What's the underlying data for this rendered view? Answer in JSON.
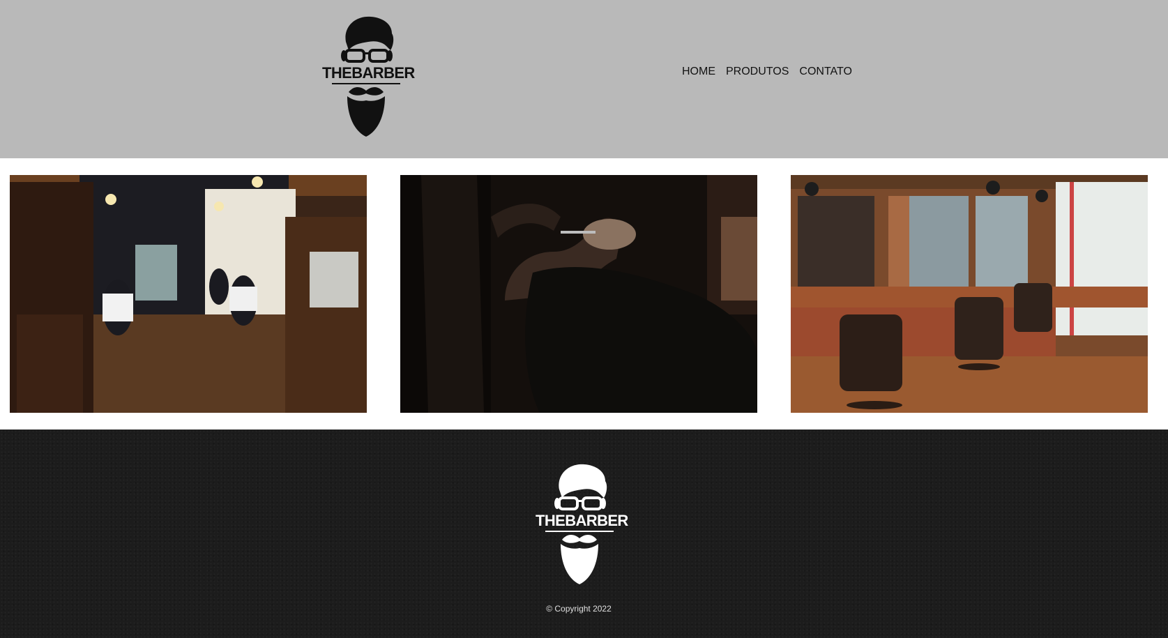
{
  "header": {
    "logo_text": "THEBARBER",
    "logo_icon": "bearded-man-glasses-icon",
    "nav": [
      {
        "label": "HOME"
      },
      {
        "label": "PRODUTOS"
      },
      {
        "label": "CONTATO"
      }
    ]
  },
  "gallery": [
    {
      "subject": "barbershop interior with white vintage chairs"
    },
    {
      "subject": "barber trimming a client's beard"
    },
    {
      "subject": "barbershop with leather chairs and brick walls"
    }
  ],
  "footer": {
    "logo_text": "THEBARBER",
    "copyright": "© Copyright 2022"
  },
  "colors": {
    "header_bg": "#b9b9b9",
    "footer_bg": "#1c1c1c",
    "nav_text": "#111111",
    "page_bg": "#ffffff"
  }
}
